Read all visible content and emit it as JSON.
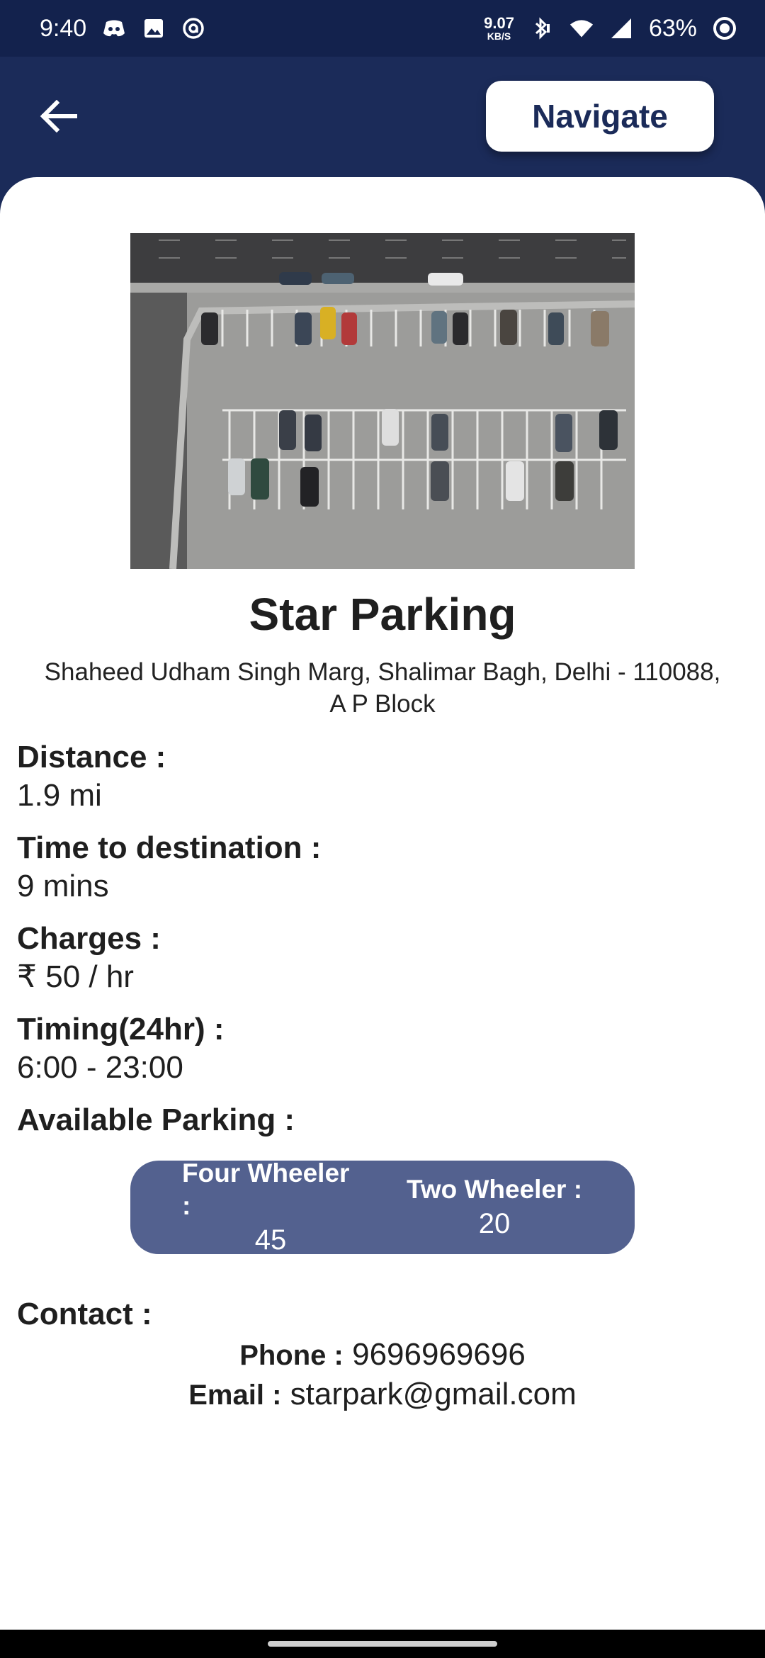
{
  "status_bar": {
    "time": "9:40",
    "net_speed_value": "9.07",
    "net_speed_unit": "KB/S",
    "battery_percent": "63%",
    "icons": [
      "discord-icon",
      "image-icon",
      "at-icon",
      "bluetooth-icon",
      "wifi-icon",
      "signal-icon",
      "battery-icon"
    ]
  },
  "header": {
    "back_icon": "arrow-left-icon",
    "navigate_label": "Navigate",
    "background_color": "#1b2b59"
  },
  "parking": {
    "photo": "parking-lot-aerial-photo",
    "name": "Star Parking",
    "address_line1": "Shaheed Udham Singh Marg, Shalimar Bagh, Delhi - 110088,",
    "address_line2": "A P Block",
    "distance_label": "Distance :",
    "distance_value": "1.9 mi",
    "time_label": "Time to destination :",
    "time_value": "9 mins",
    "charges_label": "Charges :",
    "charges_value": "₹ 50 / hr",
    "timing_label": "Timing(24hr) :",
    "timing_value": "6:00 - 23:00",
    "available_label": "Available Parking :",
    "four_wheeler_label": "Four Wheeler :",
    "four_wheeler_value": "45",
    "two_wheeler_label": "Two Wheeler :",
    "two_wheeler_value": "20",
    "available_box_color": "#53618f"
  },
  "contact": {
    "label": "Contact :",
    "phone_label": "Phone :",
    "phone_value": "9696969696",
    "email_label": "Email :",
    "email_value": "starpark@gmail.com"
  }
}
